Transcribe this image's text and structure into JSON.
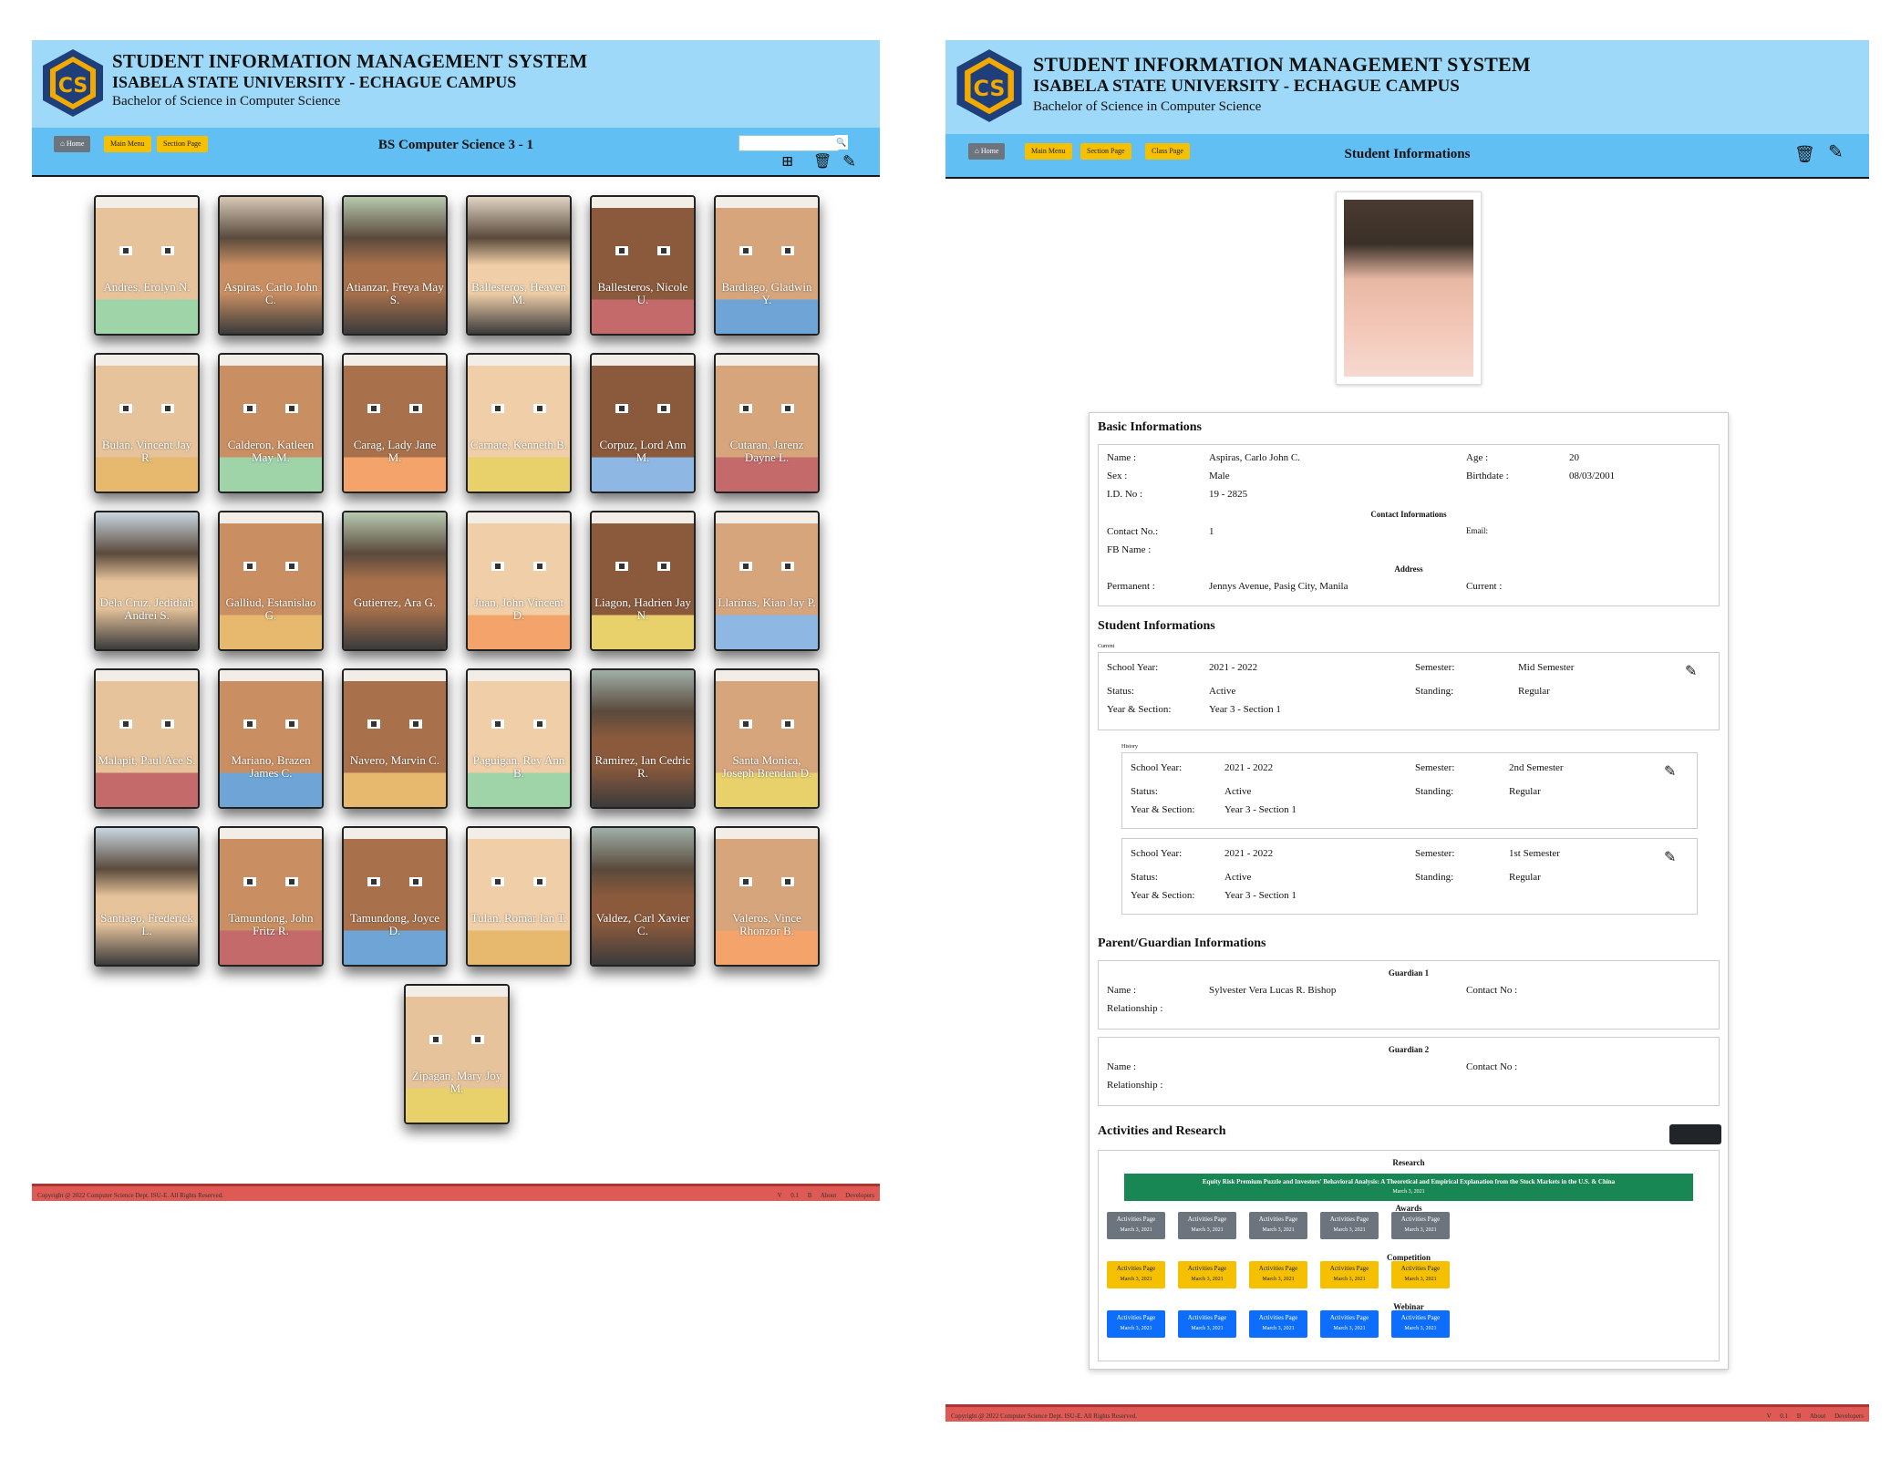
{
  "header": {
    "title": "STUDENT INFORMATION MANAGEMENT SYSTEM",
    "campus": "ISABELA STATE UNIVERSITY - ECHAGUE CAMPUS",
    "program": "Bachelor of Science in Computer Science"
  },
  "colors": {
    "header_bg": "#9fd9f9",
    "nav_bg": "#62bff3",
    "footer_bg": "#e05a55",
    "warn": "#f5c000",
    "research": "#198754",
    "blue": "#0d6efd",
    "gray": "#6c757d"
  },
  "left": {
    "nav": {
      "home": "Home",
      "main_menu": "Main Menu",
      "section_page": "Section Page"
    },
    "page_title": "BS Computer Science 3 - 1",
    "search_placeholder": "",
    "students": [
      {
        "name": "Andres, Erolyn N.",
        "style": "avatar"
      },
      {
        "name": "Aspiras, Carlo John C.",
        "style": "photo"
      },
      {
        "name": "Atianzar, Freya May S.",
        "style": "photo"
      },
      {
        "name": "Ballesteros, Heaven M.",
        "style": "photo"
      },
      {
        "name": "Ballesteros, Nicole U.",
        "style": "avatar"
      },
      {
        "name": "Bardiago, Gladwin Y.",
        "style": "avatar"
      },
      {
        "name": "Bulan, Vincent Jay R.",
        "style": "avatar"
      },
      {
        "name": "Calderon, Katleen May M.",
        "style": "avatar"
      },
      {
        "name": "Carag, Lady Jane M.",
        "style": "avatar"
      },
      {
        "name": "Carnate, Kenneth B.",
        "style": "avatar"
      },
      {
        "name": "Corpuz, Lord Ann M.",
        "style": "avatar"
      },
      {
        "name": "Cutaran, Jarenz Dayne L.",
        "style": "avatar"
      },
      {
        "name": "Dela Cruz, Jedidiah Andrei S.",
        "style": "photo"
      },
      {
        "name": "Galliud, Estanislao G.",
        "style": "avatar"
      },
      {
        "name": "Gutierrez, Ara G.",
        "style": "photo"
      },
      {
        "name": "Juan, John Vincent D.",
        "style": "avatar"
      },
      {
        "name": "Liagon, Hadrien Jay N.",
        "style": "avatar"
      },
      {
        "name": "Llarinas, Kian Jay P.",
        "style": "avatar"
      },
      {
        "name": "Malapit, Paul Ace S.",
        "style": "avatar"
      },
      {
        "name": "Mariano, Brazen James C.",
        "style": "avatar"
      },
      {
        "name": "Navero, Marvin C.",
        "style": "avatar"
      },
      {
        "name": "Paguigan, Rey Ann B.",
        "style": "avatar"
      },
      {
        "name": "Ramirez, Ian Cedric R.",
        "style": "photo"
      },
      {
        "name": "Santa Monica, Joseph Brendan D.",
        "style": "avatar"
      },
      {
        "name": "Santiago, Frederick L.",
        "style": "photo"
      },
      {
        "name": "Tamundong, John Fritz R.",
        "style": "avatar"
      },
      {
        "name": "Tamundong, Joyce D.",
        "style": "avatar"
      },
      {
        "name": "Tulan, Romar Ian T.",
        "style": "avatar"
      },
      {
        "name": "Valdez, Carl Xavier C.",
        "style": "photo"
      },
      {
        "name": "Valeros, Vince Rhonzor B.",
        "style": "avatar"
      },
      {
        "name": "Zipagan, Mary Joy M.",
        "style": "avatar"
      }
    ]
  },
  "right": {
    "nav": {
      "home": "Home",
      "main_menu": "Main Menu",
      "section_page": "Section Page",
      "class_page": "Class Page"
    },
    "page_title": "Student Informations",
    "basic": {
      "heading": "Basic Informations",
      "name_label": "Name :",
      "name": "Aspiras, Carlo John C.",
      "sex_label": "Sex :",
      "sex": "Male",
      "id_label": "I.D. No :",
      "id": "19 - 2825",
      "age_label": "Age :",
      "age": "20",
      "birthdate_label": "Birthdate :",
      "birthdate": "08/03/2001",
      "contact_heading": "Contact Informations",
      "contact_label": "Contact No.:",
      "contact": "1",
      "email_label": "Email:",
      "fb_label": "FB Name :",
      "address_heading": "Address",
      "permanent_label": "Permanent :",
      "permanent": "Jennys Avenue, Pasig City, Manila",
      "current_label": "Current :"
    },
    "student": {
      "heading": "Student Informations",
      "current_label": "Current",
      "history_label": "History",
      "labels": {
        "sy": "School Year:",
        "sem": "Semester:",
        "status": "Status:",
        "standing": "Standing:",
        "ys": "Year & Section:"
      },
      "current": {
        "sy": "2021 - 2022",
        "sem": "Mid Semester",
        "status": "Active",
        "standing": "Regular",
        "ys": "Year 3 - Section 1"
      },
      "history": [
        {
          "sy": "2021 - 2022",
          "sem": "2nd Semester",
          "status": "Active",
          "standing": "Regular",
          "ys": "Year 3 - Section 1"
        },
        {
          "sy": "2021 - 2022",
          "sem": "1st Semester",
          "status": "Active",
          "standing": "Regular",
          "ys": "Year 3 - Section 1"
        }
      ]
    },
    "parent": {
      "heading": "Parent/Guardian Informations",
      "g1_heading": "Guardian 1",
      "g1_name": "Sylvester Vera Lucas R. Bishop",
      "g2_heading": "Guardian 2",
      "name_label": "Name :",
      "relationship_label": "Relationship :",
      "contact_label": "Contact No :"
    },
    "activities": {
      "heading": "Activities and Research",
      "research_heading": "Research",
      "research_title": "Equity Risk Premium Puzzle and Investors' Behavioral Analysis: A Theoretical and Empirical Explanation from the Stock Markets in the U.S. & China",
      "research_date": "March 3, 2021",
      "awards_heading": "Awards",
      "competition_heading": "Competition",
      "webinar_heading": "Webinar",
      "item_label": "Activities Page",
      "item_date": "March 3, 2021"
    }
  },
  "footer": {
    "copyright": "Copyright @ 2022 Computer Science Dept. ISU-E. All Rights Reserved.",
    "version": "V 0.1 B",
    "about": "About Developers"
  }
}
